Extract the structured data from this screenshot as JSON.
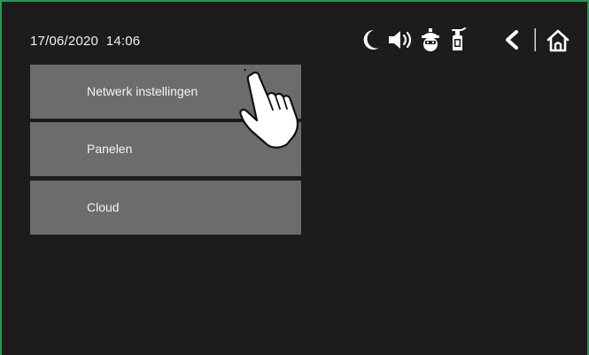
{
  "status_bar": {
    "datetime": "17/06/2020  14:06",
    "icons": [
      "moon-icon",
      "speaker-icon",
      "burglar-icon",
      "fire-extinguisher-icon",
      "back-icon",
      "home-icon"
    ]
  },
  "menu": {
    "items": [
      {
        "label": "Netwerk instellingen"
      },
      {
        "label": "Panelen"
      },
      {
        "label": "Cloud"
      }
    ]
  },
  "colors": {
    "background": "#1d1b1b",
    "frame": "#1a9e55",
    "menu_item": "#6b6d6b",
    "text": "#f4f4f4"
  }
}
